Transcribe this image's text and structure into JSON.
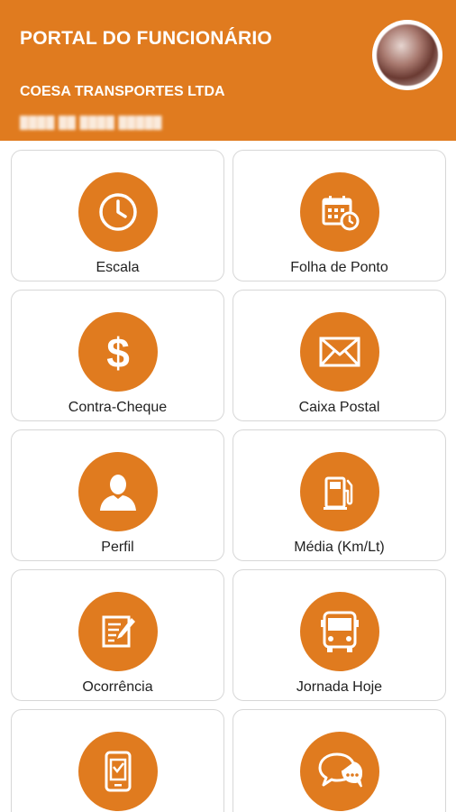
{
  "header": {
    "title": "PORTAL DO FUNCIONÁRIO",
    "company": "COESA TRANSPORTES LTDA"
  },
  "colors": {
    "accent": "#E07B1F",
    "background": "#FFFFFF",
    "text": "#222222"
  },
  "menu": [
    {
      "label": "Escala",
      "icon": "clock-icon"
    },
    {
      "label": "Folha de Ponto",
      "icon": "calendar-clock-icon"
    },
    {
      "label": "Contra-Cheque",
      "icon": "dollar-icon"
    },
    {
      "label": "Caixa Postal",
      "icon": "envelope-icon"
    },
    {
      "label": "Perfil",
      "icon": "user-icon"
    },
    {
      "label": "Média (Km/Lt)",
      "icon": "fuel-pump-icon"
    },
    {
      "label": "Ocorrência",
      "icon": "edit-note-icon"
    },
    {
      "label": "Jornada Hoje",
      "icon": "bus-icon"
    },
    {
      "label": "",
      "icon": "mobile-ticket-icon"
    },
    {
      "label": "",
      "icon": "chat-icon"
    }
  ]
}
